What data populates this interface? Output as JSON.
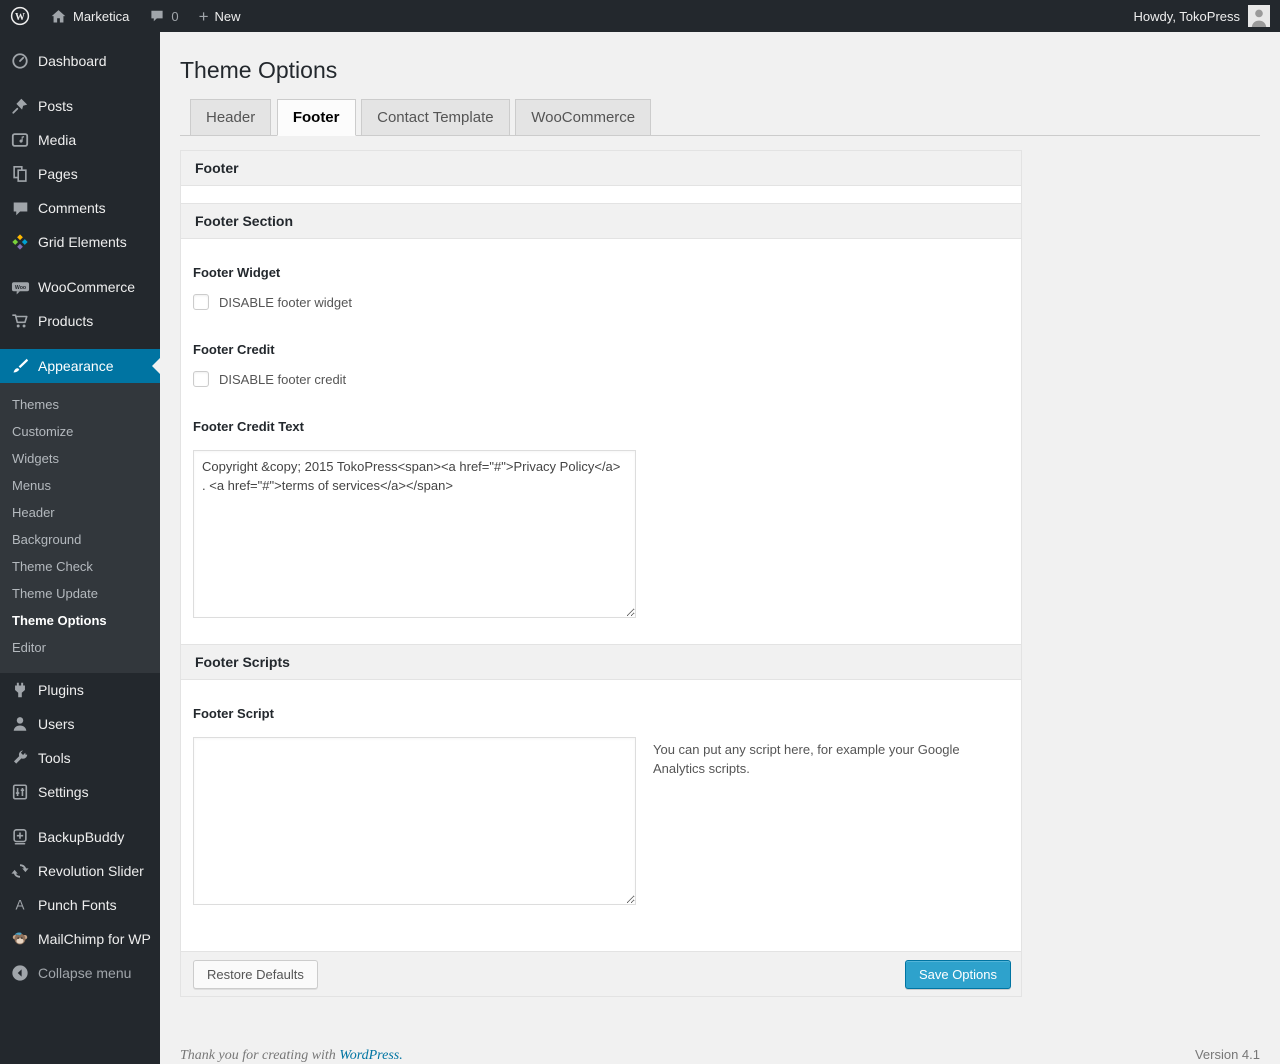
{
  "admin_bar": {
    "site_name": "Marketica",
    "comments_count": "0",
    "new_plus": "+",
    "new_label": "New",
    "howdy": "Howdy, TokoPress"
  },
  "sidebar": {
    "items": [
      {
        "label": "Dashboard"
      },
      {
        "label": "Posts"
      },
      {
        "label": "Media"
      },
      {
        "label": "Pages"
      },
      {
        "label": "Comments"
      },
      {
        "label": "Grid Elements"
      },
      {
        "label": "WooCommerce"
      },
      {
        "label": "Products"
      },
      {
        "label": "Appearance",
        "active": true
      },
      {
        "label": "Plugins"
      },
      {
        "label": "Users"
      },
      {
        "label": "Tools"
      },
      {
        "label": "Settings"
      },
      {
        "label": "BackupBuddy"
      },
      {
        "label": "Revolution Slider"
      },
      {
        "label": "Punch Fonts"
      },
      {
        "label": "MailChimp for WP"
      }
    ],
    "appearance_submenu": [
      "Themes",
      "Customize",
      "Widgets",
      "Menus",
      "Header",
      "Background",
      "Theme Check",
      "Theme Update",
      "Theme Options",
      "Editor"
    ],
    "current_submenu_item": "Theme Options",
    "collapse_label": "Collapse menu"
  },
  "page": {
    "title": "Theme Options",
    "tabs": [
      {
        "label": "Header"
      },
      {
        "label": "Footer",
        "active": true
      },
      {
        "label": "Contact Template"
      },
      {
        "label": "WooCommerce"
      }
    ]
  },
  "panel": {
    "title": "Footer",
    "footer_section": {
      "title": "Footer Section",
      "widget_label": "Footer Widget",
      "widget_checkbox_label": "DISABLE footer widget",
      "widget_checked": false,
      "credit_label": "Footer Credit",
      "credit_checkbox_label": "DISABLE footer credit",
      "credit_checked": false,
      "credit_text_label": "Footer Credit Text",
      "credit_text_value": "Copyright &copy; 2015 TokoPress<span><a href=\"#\">Privacy Policy</a> . <a href=\"#\">terms of services</a></span>"
    },
    "footer_scripts": {
      "title": "Footer Scripts",
      "script_label": "Footer Script",
      "script_value": "",
      "help_text": "You can put any script here, for example your Google Analytics scripts."
    },
    "buttons": {
      "restore": "Restore Defaults",
      "save": "Save Options"
    }
  },
  "footer": {
    "thanks_prefix": "Thank you for creating with",
    "wordpress_link": "WordPress.",
    "version": "Version 4.1"
  },
  "icons": {
    "wordpress-logo": "circled W",
    "home-icon": "house",
    "comment-icon": "speech bubble",
    "plus-icon": "+",
    "avatar": "person silhouette",
    "dashboard-icon": "gauge",
    "posts-icon": "pushpin",
    "media-icon": "photo/music frame",
    "pages-icon": "stacked pages",
    "comments-icon": "speech bubble",
    "grid-elements-icon": "colored pinwheel diamonds",
    "woocommerce-icon": "Woo badge",
    "products-icon": "shopping cart",
    "appearance-icon": "paint brush",
    "plugins-icon": "power plug",
    "users-icon": "person",
    "tools-icon": "wrench",
    "settings-icon": "slider panel",
    "backupbuddy-icon": "backup disk with plus",
    "revolution-slider-icon": "circular arrows",
    "punch-fonts-icon": "letter A",
    "mailchimp-icon": "monkey face",
    "collapse-icon": "circle left arrow"
  },
  "colors": {
    "admin_bar_bg": "#23282d",
    "menu_bg": "#23282d",
    "submenu_bg": "#32373c",
    "accent": "#0074a2",
    "primary_button": "#2ea2cc",
    "page_bg": "#f1f1f1",
    "link": "#0074a2"
  }
}
